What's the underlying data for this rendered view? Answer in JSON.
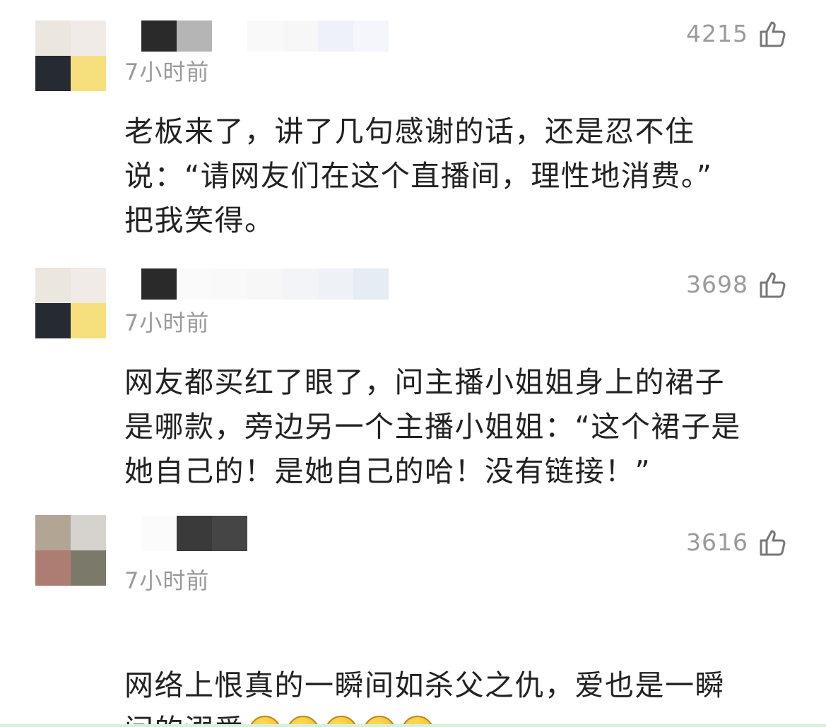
{
  "comments": [
    {
      "time": "7小时前",
      "likes": "4215",
      "text": "老板来了，讲了几句感谢的话，还是忍不住\n说：“请网友们在这个直播间，理性地消费。”\n把我笑得。",
      "avatar_colors": [
        "#ebe7de",
        "#f0ebe6",
        "#252a33",
        "#f6e07e"
      ]
    },
    {
      "time": "7小时前",
      "likes": "3698",
      "text": "网友都买红了眼了，问主播小姐姐身上的裙子\n是哪款，旁边另一个主播小姐姐：“这个裙子是\n她自己的！是她自己的哈！没有链接！”",
      "avatar_colors": [
        "#ebe7de",
        "#f0ebe6",
        "#252a33",
        "#f6e07e"
      ]
    },
    {
      "time": "7小时前",
      "likes": "3616",
      "text": "网络上恨真的一瞬间如杀父之仇，爱也是一瞬\n间的溺爱",
      "emoji_count": 5,
      "emoji_name": "crying-laughing-emoji",
      "avatar_colors": [
        "#b3a594",
        "#d6d3cf",
        "#ad7c73",
        "#7b7a6a"
      ]
    }
  ],
  "icons": {
    "like": "thumbs-up-icon"
  }
}
